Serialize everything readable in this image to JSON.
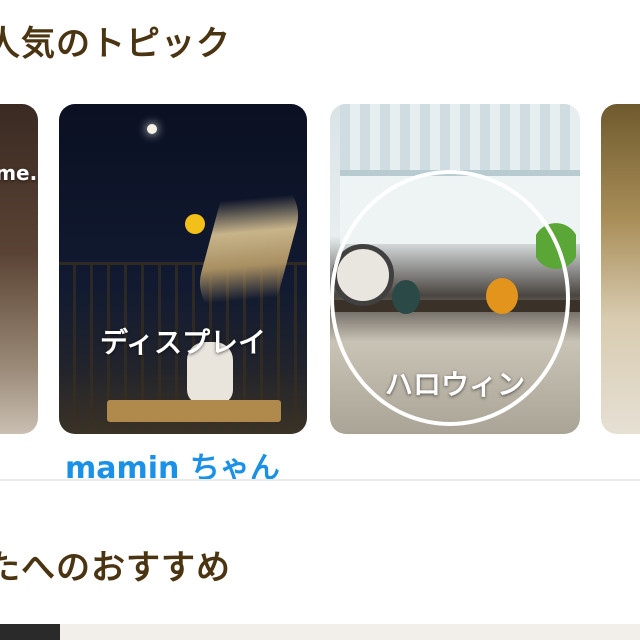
{
  "sections": {
    "topics_title": "人気のトピック",
    "recommend_title": "たへのおすすめ"
  },
  "cards": [
    {
      "label": "..me..",
      "partial": true
    },
    {
      "label": "ディスプレイ"
    },
    {
      "label": "ハロウィン"
    },
    {
      "label": "",
      "partial": true
    }
  ],
  "user_link": "mamin ちゃん",
  "colors": {
    "title": "#4a3412",
    "link": "#1a91e6",
    "divider": "#ebebeb",
    "card_label": "#ffffff"
  }
}
